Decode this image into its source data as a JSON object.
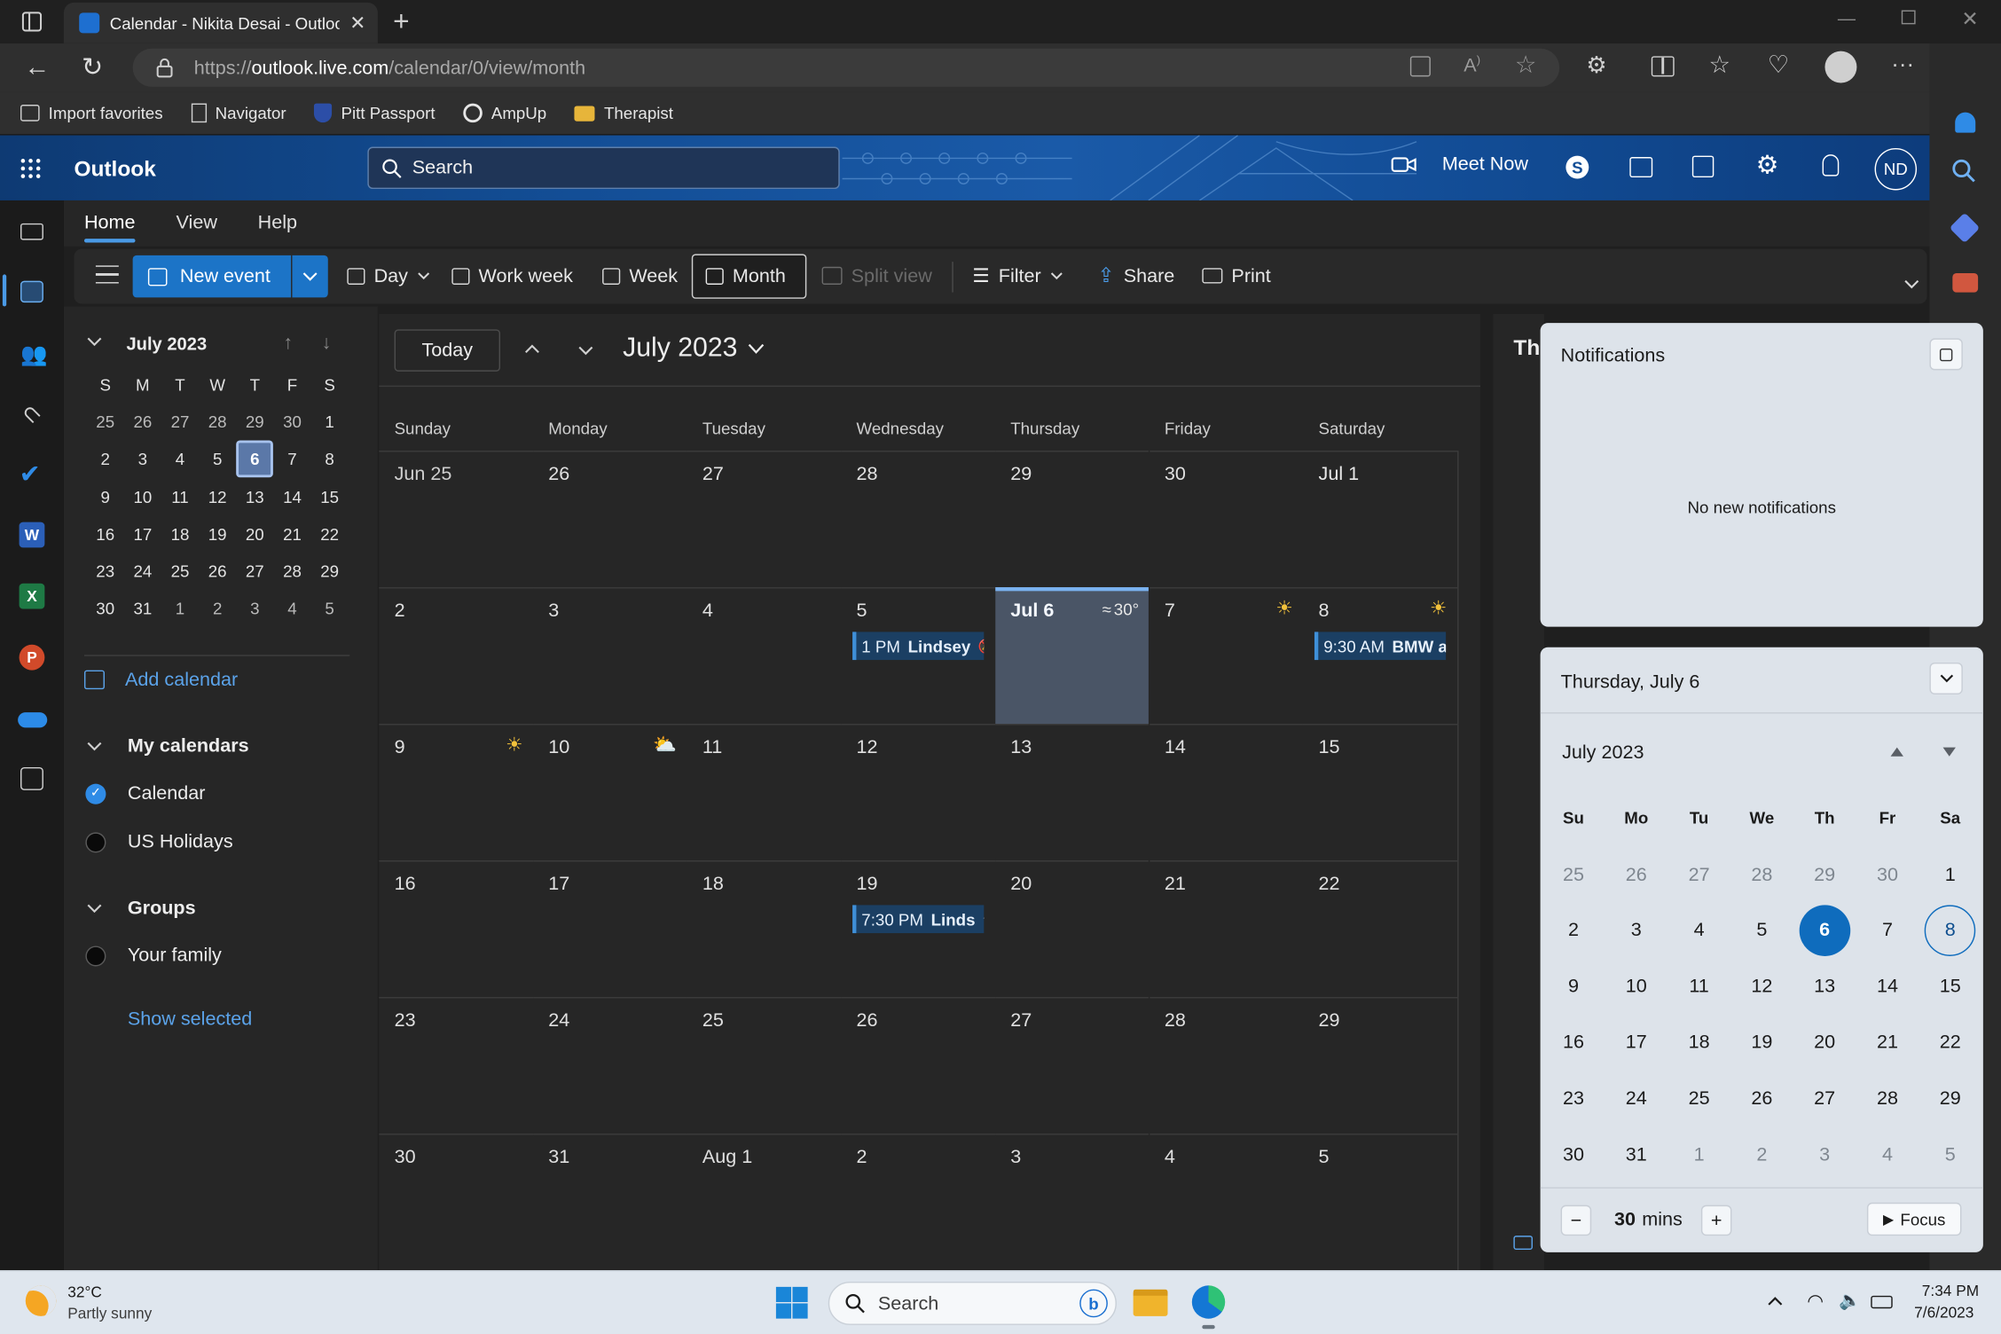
{
  "browser": {
    "tab_title": "Calendar - Nikita Desai - Outlook",
    "url_prefix": "https://",
    "url_domain": "outlook.live.com",
    "url_path": "/calendar/0/view/month",
    "favorites": [
      "Import favorites",
      "Navigator",
      "Pitt Passport",
      "AmpUp",
      "Therapist"
    ]
  },
  "outlook": {
    "app_name": "Outlook",
    "search_placeholder": "Search",
    "meet_now": "Meet Now",
    "avatar": "ND",
    "ribbon_tabs": [
      "Home",
      "View",
      "Help"
    ],
    "ribbon": {
      "new_event": "New event",
      "day": "Day",
      "work_week": "Work week",
      "week": "Week",
      "month": "Month",
      "split_view": "Split view",
      "filter": "Filter",
      "share": "Share",
      "print": "Print"
    }
  },
  "mini_calendar": {
    "title": "July 2023",
    "weekdays": [
      "S",
      "M",
      "T",
      "W",
      "T",
      "F",
      "S"
    ],
    "weeks": [
      [
        "25",
        "26",
        "27",
        "28",
        "29",
        "30",
        "1"
      ],
      [
        "2",
        "3",
        "4",
        "5",
        "6",
        "7",
        "8"
      ],
      [
        "9",
        "10",
        "11",
        "12",
        "13",
        "14",
        "15"
      ],
      [
        "16",
        "17",
        "18",
        "19",
        "20",
        "21",
        "22"
      ],
      [
        "23",
        "24",
        "25",
        "26",
        "27",
        "28",
        "29"
      ],
      [
        "30",
        "31",
        "1",
        "2",
        "3",
        "4",
        "5"
      ]
    ],
    "selected": "6"
  },
  "nav": {
    "add_calendar": "Add calendar",
    "my_calendars": "My calendars",
    "calendars": [
      "Calendar",
      "US Holidays"
    ],
    "groups": "Groups",
    "group_items": [
      "Your family"
    ],
    "show_selected": "Show selected"
  },
  "month_view": {
    "today_btn": "Today",
    "title": "July 2023",
    "day_headers": [
      "Sunday",
      "Monday",
      "Tuesday",
      "Wednesday",
      "Thursday",
      "Friday",
      "Saturday"
    ],
    "weeks": [
      [
        "Jun 25",
        "26",
        "27",
        "28",
        "29",
        "30",
        "Jul 1"
      ],
      [
        "2",
        "3",
        "4",
        "5",
        "Jul 6",
        "7",
        "8"
      ],
      [
        "9",
        "10",
        "11",
        "12",
        "13",
        "14",
        "15"
      ],
      [
        "16",
        "17",
        "18",
        "19",
        "20",
        "21",
        "22"
      ],
      [
        "23",
        "24",
        "25",
        "26",
        "27",
        "28",
        "29"
      ],
      [
        "30",
        "31",
        "Aug 1",
        "2",
        "3",
        "4",
        "5"
      ]
    ],
    "today_temp": "30°",
    "events": [
      {
        "time": "1 PM",
        "title": "Lindsey"
      },
      {
        "time": "9:30 AM",
        "title": "BMW au"
      },
      {
        "time": "7:30 PM",
        "title": "Linds"
      }
    ],
    "right_peek": "Th"
  },
  "notifications": {
    "title": "Notifications",
    "empty": "No new notifications"
  },
  "calendar_flyout": {
    "date_header": "Thursday, July 6",
    "month": "July 2023",
    "weekdays": [
      "Su",
      "Mo",
      "Tu",
      "We",
      "Th",
      "Fr",
      "Sa"
    ],
    "weeks": [
      [
        "25",
        "26",
        "27",
        "28",
        "29",
        "30",
        "1"
      ],
      [
        "2",
        "3",
        "4",
        "5",
        "6",
        "7",
        "8"
      ],
      [
        "9",
        "10",
        "11",
        "12",
        "13",
        "14",
        "15"
      ],
      [
        "16",
        "17",
        "18",
        "19",
        "20",
        "21",
        "22"
      ],
      [
        "23",
        "24",
        "25",
        "26",
        "27",
        "28",
        "29"
      ],
      [
        "30",
        "31",
        "1",
        "2",
        "3",
        "4",
        "5"
      ]
    ],
    "focus_minutes": "30",
    "focus_unit": "mins",
    "focus_btn": "Focus"
  },
  "taskbar": {
    "weather_temp": "32°C",
    "weather_desc": "Partly sunny",
    "search": "Search",
    "time": "7:34 PM",
    "date": "7/6/2023"
  },
  "colors": {
    "accent": "#0f6cbd",
    "header_blue": "#134e96",
    "today_cell": "#4a5566"
  }
}
